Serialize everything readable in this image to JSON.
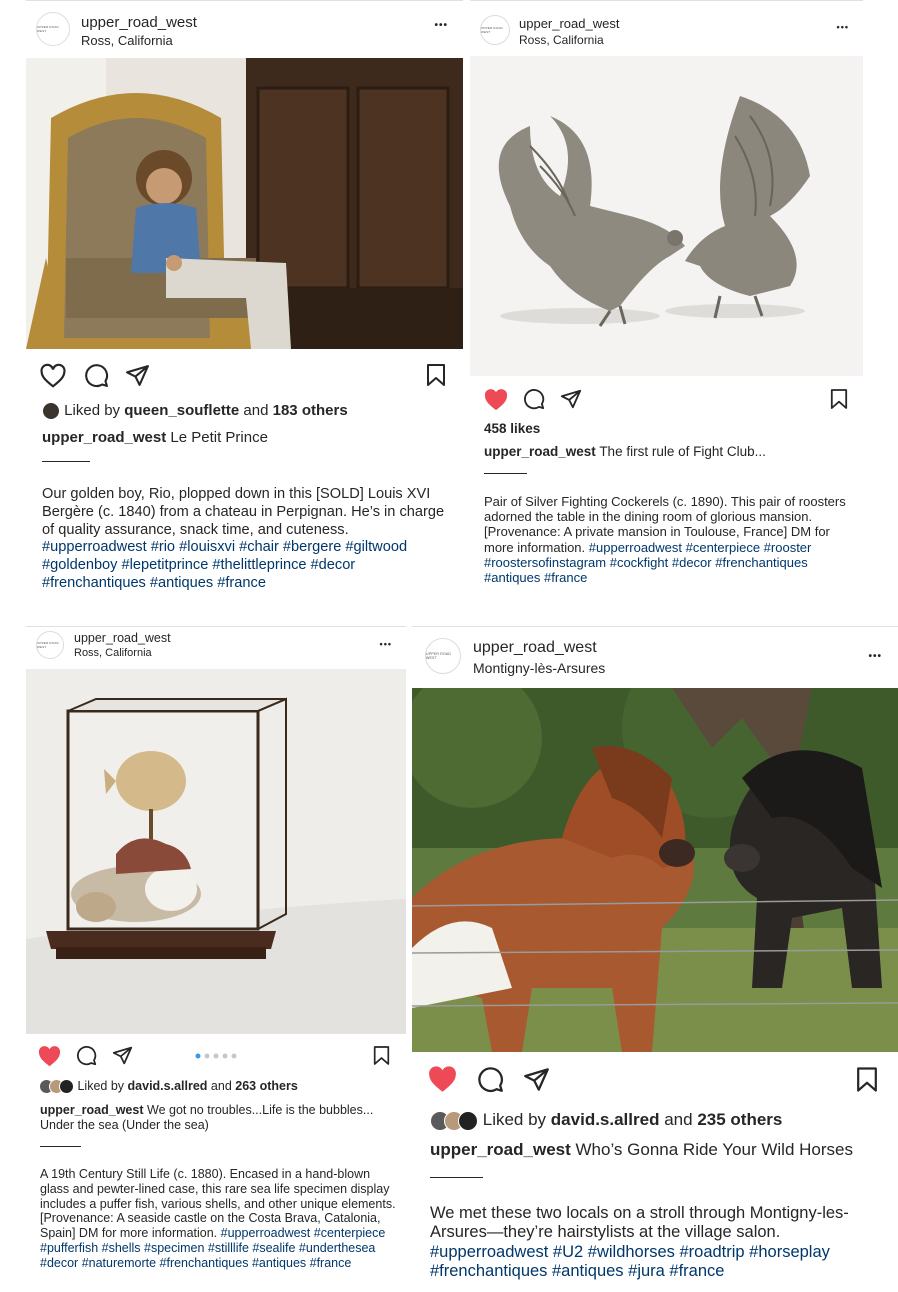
{
  "posts": [
    {
      "username": "upper_road_west",
      "location": "Ross, California",
      "avatar_text": "UPPER ROAD WEST",
      "liked_prefix": "Liked by",
      "liked_user": "queen_souflette",
      "liked_and": "and",
      "liked_others": "183 others",
      "caption_title": "Le Petit Prince",
      "caption_body": "Our golden boy, Rio, plopped down in this [SOLD] Louis XVI Bergère (c. 1840) from a chateau in Perpignan. He’s in charge of quality assurance, snack time, and cuteness.",
      "hashtags": "#upperroadwest #rio #louisxvi #chair #bergere #giltwood #goldenboy #lepetitprince #thelittleprince #decor #frenchantiques #antiques #france",
      "liked": false
    },
    {
      "username": "upper_road_west",
      "location": "Ross, California",
      "avatar_text": "UPPER ROAD WEST",
      "likes": "458 likes",
      "caption_title": "The first rule of Fight Club...",
      "caption_body": "Pair of Silver Fighting Cockerels (c. 1890). This pair of roosters adorned the table in the dining room of glorious mansion. [Provenance: A private mansion in Toulouse, France] DM for more information.",
      "hashtags": "#upperroadwest #centerpiece #rooster #roostersofinstagram #cockfight #decor #frenchantiques #antiques #france",
      "liked": true
    },
    {
      "username": "upper_road_west",
      "location": "Ross, California",
      "avatar_text": "UPPER ROAD WEST",
      "liked_prefix": "Liked by",
      "liked_user": "david.s.allred",
      "liked_and": "and",
      "liked_others": "263 others",
      "caption_title": "We got no troubles...Life is the bubbles... Under the sea (Under the sea)",
      "caption_body": "A 19th Century Still Life (c. 1880). Encased in a hand-blown glass and pewter-lined case, this rare sea life specimen display includes a puffer fish, various shells, and other unique elements. [Provenance: A seaside castle on the Costa Brava, Catalonia, Spain] DM for more information.",
      "hashtags": "#upperroadwest #centerpiece #pufferfish #shells #specimen #stilllife #sealife #underthesea #decor #naturemorte #frenchantiques #antiques #france",
      "carousel_count": 5,
      "carousel_active": 1,
      "liked": true
    },
    {
      "username": "upper_road_west",
      "location": "Montigny-lès-Arsures",
      "avatar_text": "UPPER ROAD WEST",
      "liked_prefix": "Liked by",
      "liked_user": "david.s.allred",
      "liked_and": "and",
      "liked_others": "235 others",
      "caption_title": "Who’s Gonna Ride Your Wild Horses",
      "caption_body": "We met these two locals on a stroll through Montigny-les-Arsures—they’re hairstylists at the village salon.",
      "hashtags": "#upperroadwest #U2 #wildhorses #roadtrip #horseplay #frenchantiques #antiques #jura #france",
      "liked": true
    }
  ],
  "menu_glyph": "•••",
  "colors": {
    "like_red": "#ed4956",
    "hashtag_blue": "#00376b",
    "text": "#262626"
  },
  "icons": [
    "heart-icon",
    "comment-icon",
    "share-icon",
    "bookmark-icon",
    "more-icon"
  ]
}
